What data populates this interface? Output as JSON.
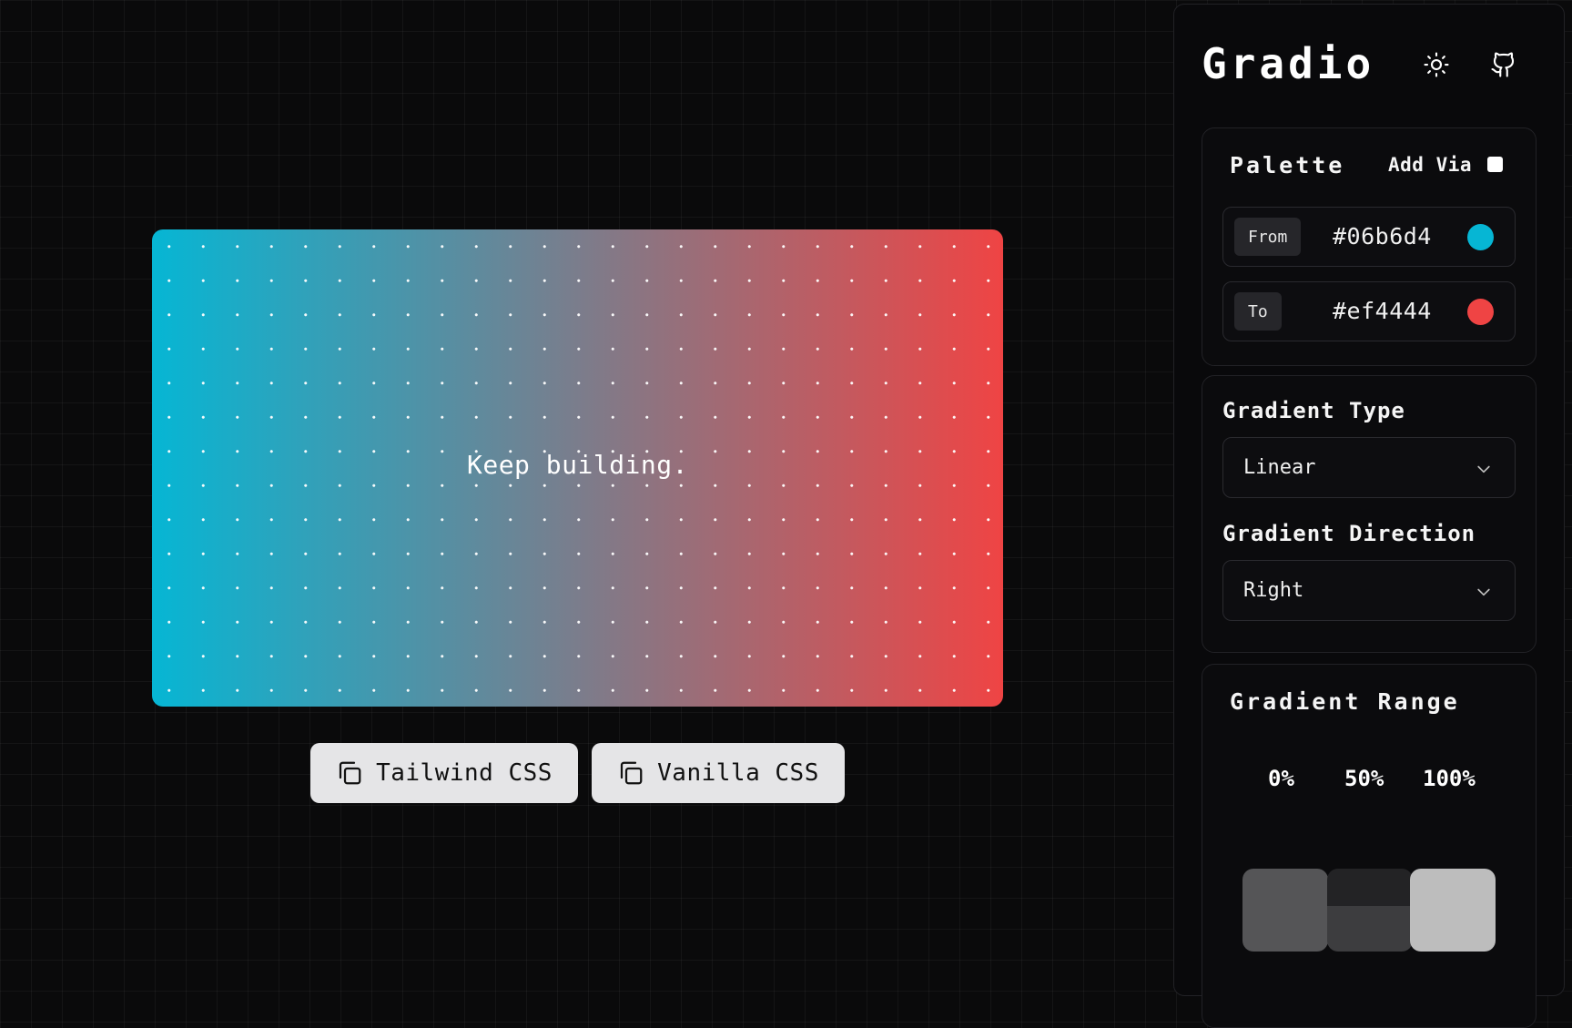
{
  "preview": {
    "text": "Keep building.",
    "gradient_type": "linear",
    "direction": "to right"
  },
  "actions": {
    "tailwind_label": "Tailwind CSS",
    "vanilla_label": "Vanilla CSS",
    "icon": "copy-icon"
  },
  "sidebar": {
    "brand": "Gradio",
    "theme_icon": "sun-icon",
    "repo_icon": "github-icon",
    "palette": {
      "title": "Palette",
      "add_via_label": "Add Via",
      "add_via_checked": false,
      "from": {
        "tag": "From",
        "hex": "#06b6d4",
        "color": "#06b6d4"
      },
      "to": {
        "tag": "To",
        "hex": "#ef4444",
        "color": "#ef4444"
      }
    },
    "gradient_type": {
      "label": "Gradient Type",
      "value": "Linear"
    },
    "gradient_direction": {
      "label": "Gradient Direction",
      "value": "Right"
    },
    "gradient_range": {
      "title": "Gradient Range",
      "stops": [
        "0%",
        "50%",
        "100%"
      ]
    }
  }
}
